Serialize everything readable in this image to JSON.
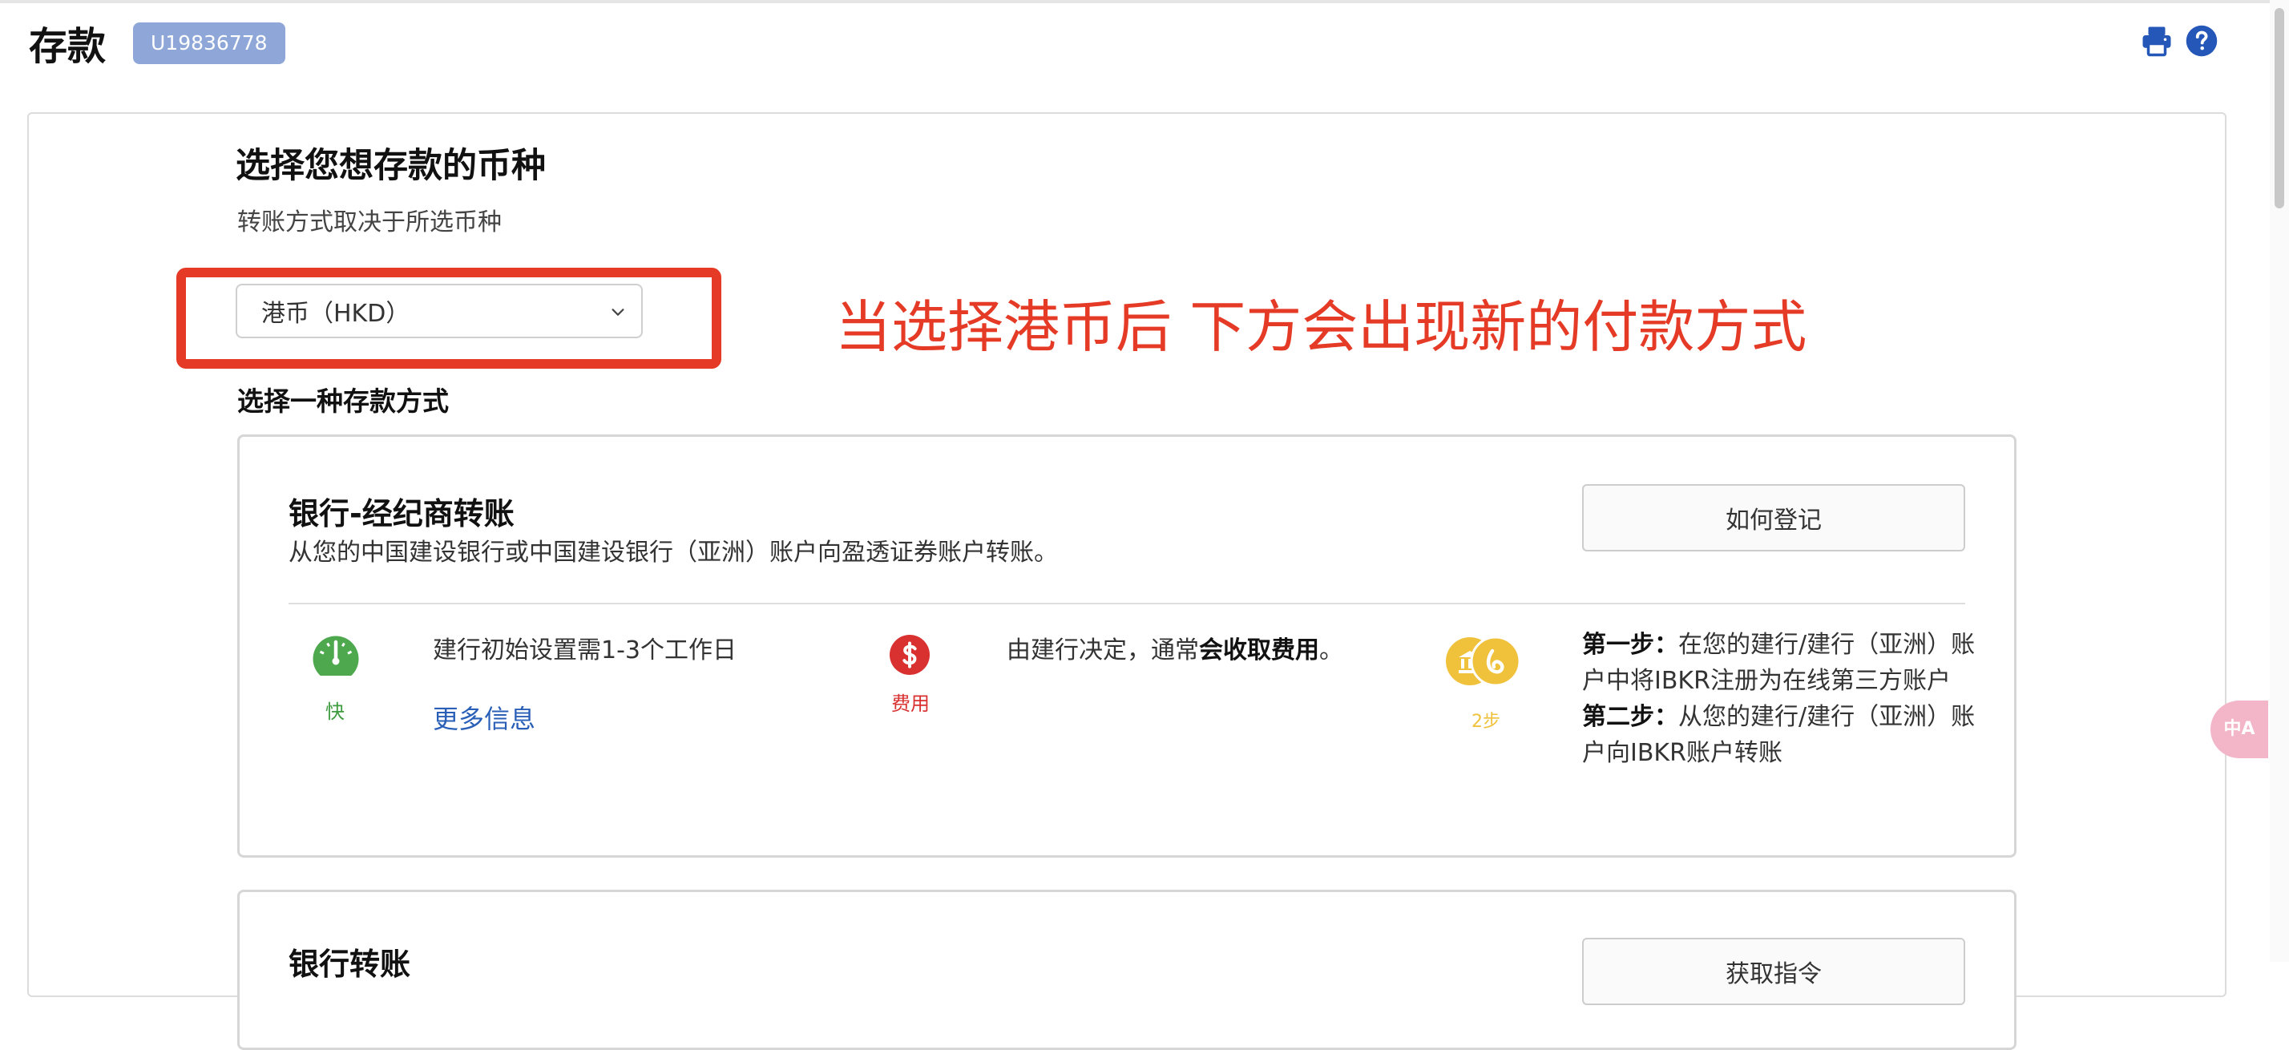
{
  "header": {
    "title": "存款",
    "account_id": "U19836778",
    "icons": [
      "print-icon",
      "help-icon"
    ]
  },
  "currency_section": {
    "title": "选择您想存款的币种",
    "subtitle": "转账方式取决于所选币种",
    "selected_currency": "港币（HKD）",
    "annotation": "当选择港币后 下方会出现新的付款方式"
  },
  "method_section": {
    "title": "选择一种存款方式"
  },
  "method_card": {
    "title": "银行-经纪商转账",
    "description": "从您的中国建设银行或中国建设银行（亚洲）账户向盈透证券账户转账。",
    "register_button": "如何登记",
    "speed": {
      "label": "快",
      "text": "建行初始设置需1-3个工作日",
      "link": "更多信息"
    },
    "fee": {
      "label": "费用",
      "text_prefix": "由建行决定，通常",
      "text_bold": "会收取费用",
      "text_suffix": "。"
    },
    "steps": {
      "label": "2步",
      "step1_label": "第一步：",
      "step1_text": "在您的建行/建行（亚洲）账户中将IBKR注册为在线第三方账户",
      "step2_label": "第二步：",
      "step2_text": "从您的建行/建行（亚洲）账户向IBKR账户转账"
    }
  },
  "method_card_2": {
    "title": "银行转账",
    "button": "获取指令"
  },
  "translate_bubble": {
    "label": "中A"
  },
  "colors": {
    "badge": "#8ea7d8",
    "annotation": "#e53a26",
    "link": "#2a5fb8",
    "speed": "#3e9b3e",
    "fee": "#d93030",
    "steps": "#f0c23c",
    "icons": "#2557b8"
  }
}
